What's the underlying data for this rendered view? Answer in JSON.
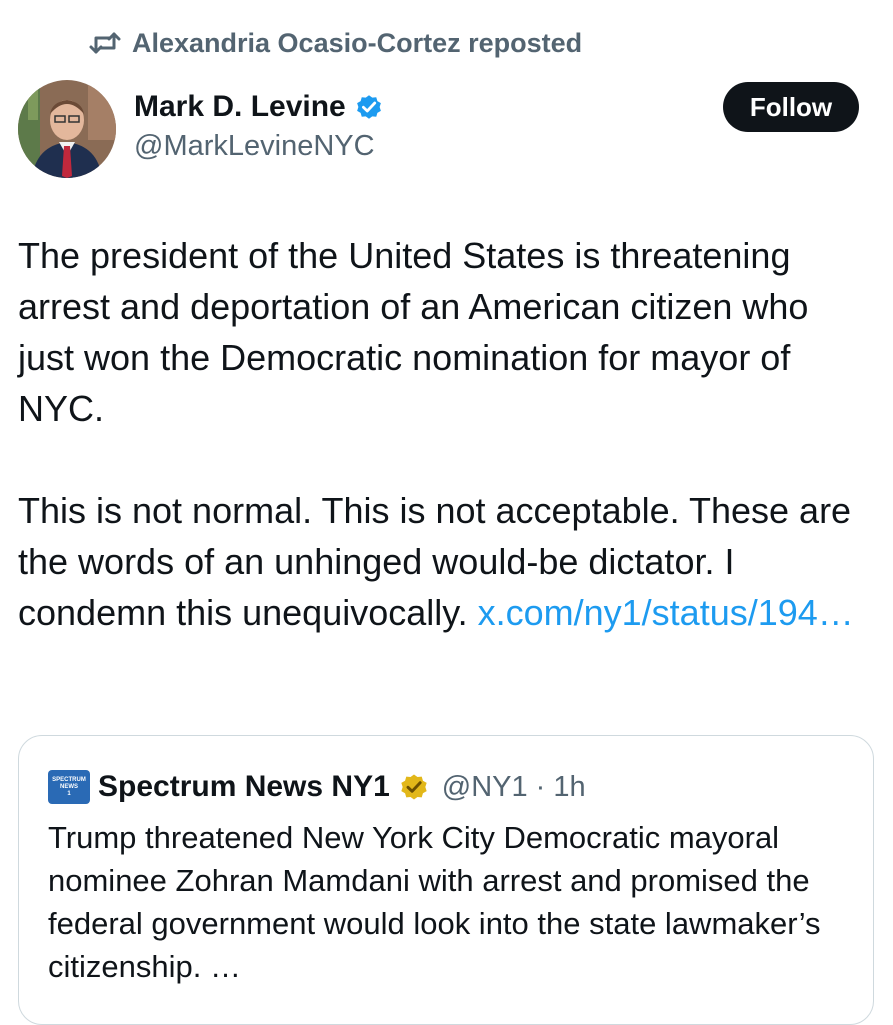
{
  "repost": {
    "icon": "repost-icon",
    "text": "Alexandria Ocasio-Cortez reposted"
  },
  "author": {
    "name": "Mark D. Levine",
    "handle": "@MarkLevineNYC",
    "verified_icon": "verified-blue-badge-icon"
  },
  "follow_button": {
    "label": "Follow"
  },
  "tweet": {
    "paragraph1": "The president of the United States is threatening arrest and deportation of an American citizen who just won the Democratic nomination for mayor of NYC.",
    "paragraph2": "This is not normal. This is not acceptable. These are the words of an unhinged would-be dictator. I condemn this unequivocally.",
    "link": "x.com/ny1/status/194…"
  },
  "quote": {
    "logo_line1": "SPECTRUM",
    "logo_line2": "NEWS",
    "logo_line3": "1",
    "name": "Spectrum News NY1",
    "badge_icon": "verified-gold-badge-icon",
    "handle": "@NY1",
    "separator": "·",
    "time": "1h",
    "text": "Trump threatened New York City Democratic mayoral nominee Zohran Mamdani with arrest and promised the federal government would look into the state lawmaker’s citizenship. …"
  },
  "colors": {
    "text": "#0f1419",
    "secondary": "#536471",
    "link": "#1d9bf0",
    "verified_blue": "#1d9bf0",
    "verified_gold": "#e2b719",
    "follow_bg": "#0f1419"
  }
}
